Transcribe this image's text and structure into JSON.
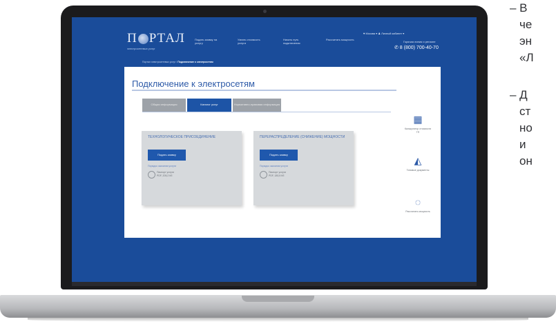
{
  "site": {
    "logo_left": "П",
    "logo_right": "РТАЛ",
    "logo_sub": "электросетевых услуг",
    "nav": [
      "Подать заявку на услугу",
      "Узнать стоимость услуги",
      "Начать путь подключения",
      "Рассчитать мощность"
    ],
    "top_right": "♥ Москва   ▾     ♟  Личный кабинет ▾",
    "phone_label": "Горячая линия и регионе",
    "phone": "✆ 8 (800) 700-40-70",
    "breadcrumb_prefix": "Портал электросетевых услуг / ",
    "breadcrumb_current": "Подключение к электросетям"
  },
  "page": {
    "title": "Подключение к электросетям",
    "tabs": [
      "Общая информация",
      "Каталог услуг",
      "Нормативно-правовая информация"
    ],
    "cards": [
      {
        "title": "ТЕХНОЛОГИЧЕСКОЕ ПРИСОЕДИНЕНИЕ",
        "button": "Подать заявку",
        "link": "Порядок оказания услуги",
        "file_name": "Паспорт услуги",
        "file_size": "PDF, 205,2 Кб"
      },
      {
        "title": "ПЕРЕРАСПРЕДЕЛЕНИЕ (СНИЖЕНИЕ) МОЩНОСТИ",
        "button": "Подать заявку",
        "link": "Порядок оказания услуги",
        "file_name": "Паспорт услуги",
        "file_size": "PDF, 180,5 Кб"
      }
    ],
    "sidebar": [
      {
        "icon": "calculator-icon",
        "label": "Калькулятор стоимости ТП"
      },
      {
        "icon": "document-icon",
        "label": "Типовые документы"
      },
      {
        "icon": "lightbulb-icon",
        "label": "Рассчитать мощность"
      }
    ]
  },
  "captions": {
    "block1": [
      "– В",
      "че",
      "эн",
      "«Л"
    ],
    "block2": [
      "– Д",
      "ст",
      "но",
      "и",
      "он"
    ]
  }
}
